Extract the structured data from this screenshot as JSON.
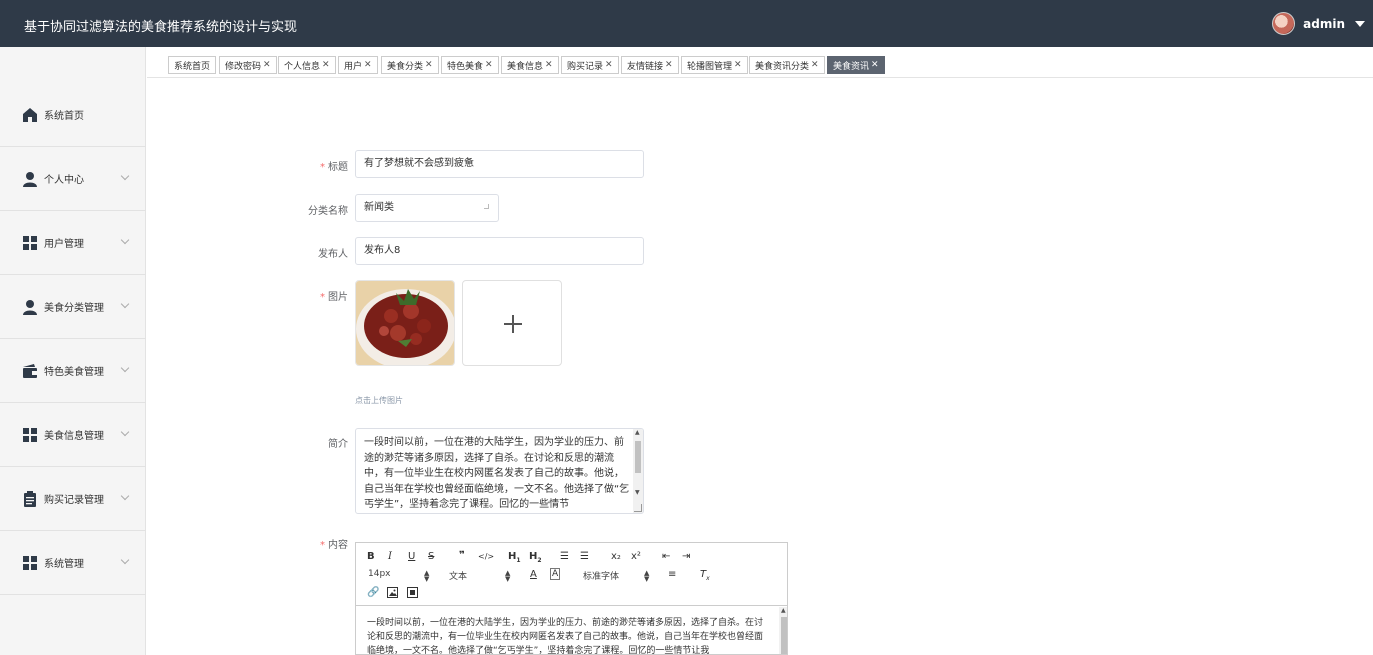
{
  "header": {
    "title": "基于协同过滤算法的美食推荐系统的设计与实现",
    "username": "admin"
  },
  "sidebar": {
    "items": [
      {
        "label": "系统首页",
        "icon": "home-icon",
        "chevron": false
      },
      {
        "label": "个人中心",
        "icon": "user-icon",
        "chevron": true
      },
      {
        "label": "用户管理",
        "icon": "grid-icon",
        "chevron": true
      },
      {
        "label": "美食分类管理",
        "icon": "user-icon",
        "chevron": true
      },
      {
        "label": "特色美食管理",
        "icon": "wallet-icon",
        "chevron": true
      },
      {
        "label": "美食信息管理",
        "icon": "grid-icon",
        "chevron": true
      },
      {
        "label": "购买记录管理",
        "icon": "clipboard-icon",
        "chevron": true
      },
      {
        "label": "系统管理",
        "icon": "grid-icon",
        "chevron": true
      }
    ]
  },
  "tabs": [
    {
      "label": "系统首页",
      "closable": false
    },
    {
      "label": "修改密码",
      "closable": true
    },
    {
      "label": "个人信息",
      "closable": true
    },
    {
      "label": "用户",
      "closable": true
    },
    {
      "label": "美食分类",
      "closable": true
    },
    {
      "label": "特色美食",
      "closable": true
    },
    {
      "label": "美食信息",
      "closable": true
    },
    {
      "label": "购买记录",
      "closable": true
    },
    {
      "label": "友情链接",
      "closable": true
    },
    {
      "label": "轮播图管理",
      "closable": true
    },
    {
      "label": "美食资讯分类",
      "closable": true
    },
    {
      "label": "美食资讯",
      "closable": true,
      "active": true
    }
  ],
  "tab_close_glyph": "✕",
  "form": {
    "title": {
      "label": "标题",
      "required": true,
      "value": "有了梦想就不会感到疲惫"
    },
    "category": {
      "label": "分类名称",
      "required": false,
      "value": "新闻类"
    },
    "publisher": {
      "label": "发布人",
      "required": false,
      "value": "发布人8"
    },
    "image": {
      "label": "图片",
      "required": true,
      "hint": "点击上传图片"
    },
    "intro": {
      "label": "简介",
      "required": false,
      "value": "一段时间以前，一位在港的大陆学生，因为学业的压力、前途的渺茫等诸多原因，选择了自杀。在讨论和反思的潮流中，有一位毕业生在校内网匿名发表了自己的故事。他说，自己当年在学校也曾经面临绝境，一文不名。他选择了做“乞丐学生”，坚持着念完了课程。回忆的一些情节"
    },
    "content": {
      "label": "内容",
      "required": true,
      "toolbar": {
        "size": "14px",
        "header": "文本",
        "font": "标准字体",
        "sub_label": "x₂",
        "sup_label": "x²"
      },
      "value": "一段时间以前，一位在港的大陆学生，因为学业的压力、前途的渺茫等诸多原因，选择了自杀。在讨论和反思的潮流中，有一位毕业生在校内网匿名发表了自己的故事。他说，自己当年在学校也曾经面临绝境，一文不名。他选择了做“乞丐学生”，坚持着念完了课程。回忆的一些情节让我"
    }
  }
}
